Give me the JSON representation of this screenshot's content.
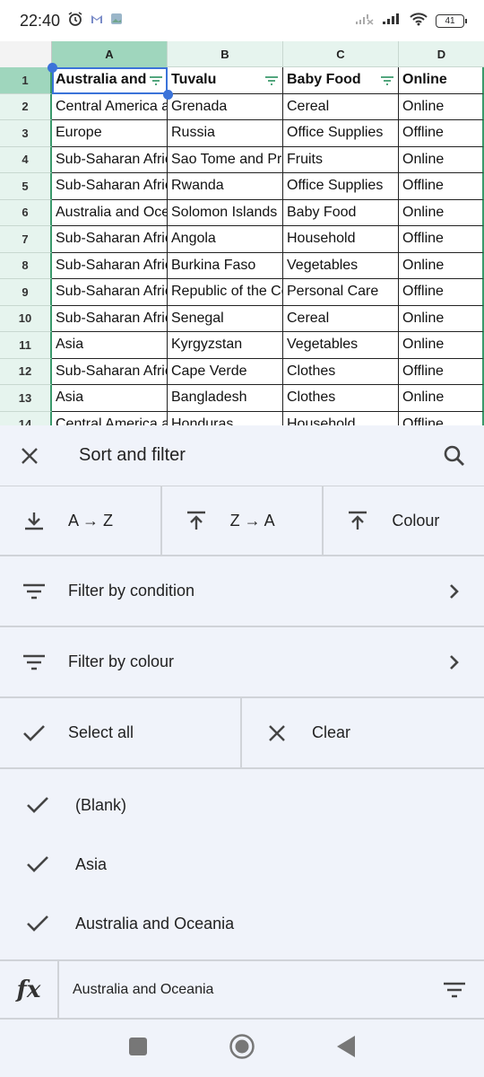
{
  "status_bar": {
    "time": "22:40",
    "battery": "41",
    "left_icons": [
      "alarm-icon",
      "gmail-icon",
      "gallery-icon"
    ],
    "right_icons": [
      "no-signal-icon",
      "signal-icon",
      "wifi-icon",
      "battery-icon"
    ]
  },
  "sheet": {
    "columns": [
      "A",
      "B",
      "C",
      "D"
    ],
    "selected_column": "A",
    "selected_cell": "A1",
    "rows": [
      {
        "num": "1",
        "cells": [
          "Australia and",
          "Tuvalu",
          "Baby Food",
          "Online"
        ]
      },
      {
        "num": "2",
        "cells": [
          "Central America a",
          "Grenada",
          "Cereal",
          "Online"
        ]
      },
      {
        "num": "3",
        "cells": [
          "Europe",
          "Russia",
          "Office Supplies",
          "Offline"
        ]
      },
      {
        "num": "4",
        "cells": [
          "Sub-Saharan Afric",
          "Sao Tome and Pri",
          "Fruits",
          "Online"
        ]
      },
      {
        "num": "5",
        "cells": [
          "Sub-Saharan Afric",
          "Rwanda",
          "Office Supplies",
          "Offline"
        ]
      },
      {
        "num": "6",
        "cells": [
          "Australia and Oce",
          "Solomon Islands",
          "Baby Food",
          "Online"
        ]
      },
      {
        "num": "7",
        "cells": [
          "Sub-Saharan Afric",
          "Angola",
          "Household",
          "Offline"
        ]
      },
      {
        "num": "8",
        "cells": [
          "Sub-Saharan Afric",
          "Burkina Faso",
          "Vegetables",
          "Online"
        ]
      },
      {
        "num": "9",
        "cells": [
          "Sub-Saharan Afric",
          "Republic of the Co",
          "Personal Care",
          "Offline"
        ]
      },
      {
        "num": "10",
        "cells": [
          "Sub-Saharan Afric",
          "Senegal",
          "Cereal",
          "Online"
        ]
      },
      {
        "num": "11",
        "cells": [
          "Asia",
          "Kyrgyzstan",
          "Vegetables",
          "Online"
        ]
      },
      {
        "num": "12",
        "cells": [
          "Sub-Saharan Afric",
          "Cape Verde",
          "Clothes",
          "Offline"
        ]
      },
      {
        "num": "13",
        "cells": [
          "Asia",
          "Bangladesh",
          "Clothes",
          "Online"
        ]
      },
      {
        "num": "14",
        "cells": [
          "Central America a",
          "Honduras",
          "Household",
          "Offline"
        ]
      }
    ]
  },
  "panel": {
    "title": "Sort and filter",
    "sort_buttons": [
      {
        "label": "A → Z",
        "icon": "sort-ascending-icon"
      },
      {
        "label": "Z → A",
        "icon": "sort-descending-icon"
      },
      {
        "label": "Colour",
        "icon": "sort-colour-icon"
      }
    ],
    "filter_by_condition": "Filter by condition",
    "filter_by_colour": "Filter by colour",
    "select_all": "Select all",
    "clear": "Clear",
    "values": [
      {
        "label": "(Blank)",
        "checked": true
      },
      {
        "label": "Asia",
        "checked": true
      },
      {
        "label": "Australia and Oceania",
        "checked": true
      }
    ]
  },
  "formula_bar": {
    "fx_label": "fx",
    "value": "Australia and Oceania"
  },
  "colors": {
    "accent_green": "#3b9a6c",
    "selection_blue": "#3b73d9",
    "panel_bg": "#f0f3fa",
    "header_selected": "#9fd6bd"
  }
}
